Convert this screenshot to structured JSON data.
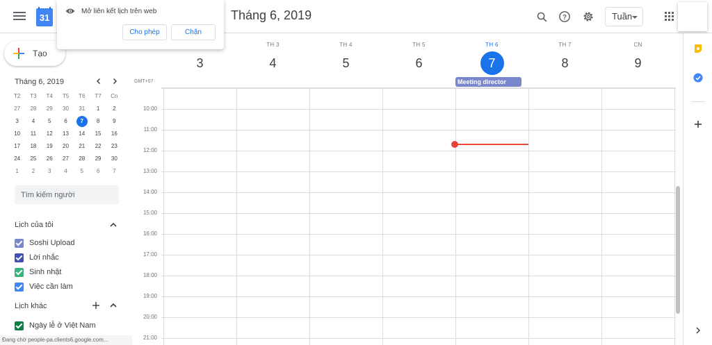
{
  "header": {
    "logo_day": "31",
    "month_title": "Tháng 6, 2019",
    "view_label": "Tuần"
  },
  "popup": {
    "message": "Mở liên kết lịch trên web",
    "allow_label": "Cho phép",
    "block_label": "Chặn"
  },
  "sidebar": {
    "create_label": "Tạo",
    "mini_calendar": {
      "title": "Tháng 6, 2019",
      "weekdays": [
        "T2",
        "T3",
        "T4",
        "T5",
        "T6",
        "T7",
        "Cn"
      ],
      "weeks": [
        [
          "27",
          "28",
          "29",
          "30",
          "31",
          "1",
          "2"
        ],
        [
          "3",
          "4",
          "5",
          "6",
          "7",
          "8",
          "9"
        ],
        [
          "10",
          "11",
          "12",
          "13",
          "14",
          "15",
          "16"
        ],
        [
          "17",
          "18",
          "19",
          "20",
          "21",
          "22",
          "23"
        ],
        [
          "24",
          "25",
          "26",
          "27",
          "28",
          "29",
          "30"
        ],
        [
          "1",
          "2",
          "3",
          "4",
          "5",
          "6",
          "7"
        ]
      ]
    },
    "search_placeholder": "Tìm kiếm người",
    "my_calendars_title": "Lịch của tôi",
    "my_calendars": [
      {
        "name": "Soshi Upload",
        "color": "#7986cb"
      },
      {
        "name": "Lời nhắc",
        "color": "#3f51b5"
      },
      {
        "name": "Sinh nhật",
        "color": "#33b679"
      },
      {
        "name": "Việc cần làm",
        "color": "#4285f4"
      }
    ],
    "other_calendars_title": "Lịch khác",
    "other_calendars": [
      {
        "name": "Ngày lễ ở Việt Nam",
        "color": "#0b8043"
      }
    ],
    "status_text": "Đang chờ people-pa.clients6.google.com..."
  },
  "week": {
    "timezone": "GMT+07",
    "days": [
      {
        "name": "",
        "num": "3"
      },
      {
        "name": "TH 3",
        "num": "4"
      },
      {
        "name": "TH 4",
        "num": "5"
      },
      {
        "name": "TH 5",
        "num": "6"
      },
      {
        "name": "TH 6",
        "num": "7",
        "today": true
      },
      {
        "name": "TH 7",
        "num": "8"
      },
      {
        "name": "CN",
        "num": "9"
      }
    ],
    "times": [
      "10:00",
      "11:00",
      "12:00",
      "13:00",
      "14:00",
      "15:00",
      "16:00",
      "17:00",
      "18:00",
      "19:00",
      "20:00",
      "21:00"
    ],
    "event_title": "Meeting director"
  },
  "colors": {
    "accent": "#1a73e8",
    "event": "#7986cb",
    "now_line": "#ea4335"
  }
}
